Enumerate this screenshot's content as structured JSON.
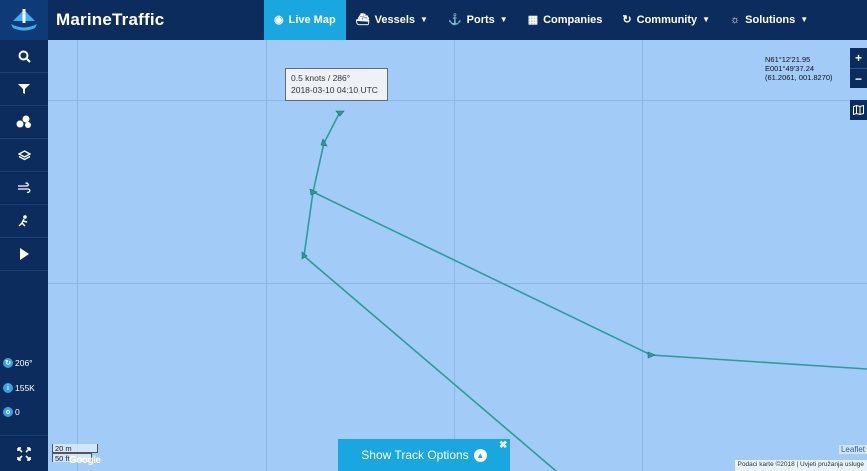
{
  "header": {
    "brand": "MarineTraffic",
    "nav": [
      {
        "label": "Live Map",
        "icon": "live-map-icon",
        "active": true,
        "caret": false
      },
      {
        "label": "Vessels",
        "icon": "ship-icon",
        "active": false,
        "caret": true
      },
      {
        "label": "Ports",
        "icon": "anchor-icon",
        "active": false,
        "caret": true
      },
      {
        "label": "Companies",
        "icon": "building-icon",
        "active": false,
        "caret": false
      },
      {
        "label": "Community",
        "icon": "community-icon",
        "active": false,
        "caret": true
      },
      {
        "label": "Solutions",
        "icon": "lightbulb-icon",
        "active": false,
        "caret": true
      }
    ]
  },
  "sidebar": {
    "buttons": [
      "search-icon",
      "filter-icon",
      "vessels-cluster-icon",
      "layers-icon",
      "wind-icon",
      "weather-icon",
      "play-icon"
    ],
    "stats": {
      "heading": "206°",
      "vessels": "155K",
      "lights": "0"
    }
  },
  "map": {
    "tooltip": {
      "speed_course": "0.5 knots / 286°",
      "timestamp": "2018-03-10 04:10 UTC"
    },
    "coords": {
      "lat": "N61°12'21.95",
      "lon": "E001°49'37.24",
      "decimal": "(61.2061, 001.8270)"
    },
    "zoom": {
      "in": "+",
      "out": "−"
    },
    "scale": {
      "metric": "20 m",
      "imperial": "50 ft"
    },
    "google_logo": "Google",
    "track_options_label": "Show Track Options",
    "leaflet_attribution": "Leaflet",
    "map_attribution": "Podaci karte ©2018 | Uvjeti pružanja usluge",
    "colors": {
      "water": "#a3cbf7",
      "track": "#2a9d9a",
      "nav": "#0c2c5e",
      "accent": "#1aa7e0"
    }
  }
}
